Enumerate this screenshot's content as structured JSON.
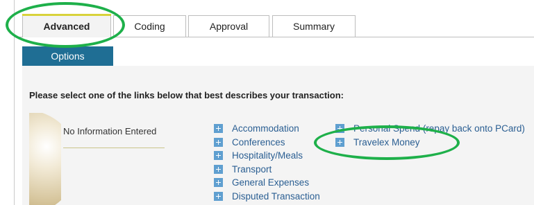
{
  "tabs": [
    {
      "label": "Advanced",
      "active": true
    },
    {
      "label": "Coding",
      "active": false
    },
    {
      "label": "Approval",
      "active": false
    },
    {
      "label": "Summary",
      "active": false
    }
  ],
  "subtab": {
    "label": "Options"
  },
  "instruction": "Please select one of the links below that best describes your transaction:",
  "info_panel": {
    "text": "No Information Entered"
  },
  "links_col1": [
    "Accommodation",
    "Conferences",
    "Hospitality/Meals",
    "Transport",
    "General Expenses",
    "Disputed Transaction"
  ],
  "links_col2": [
    "Personal Spend (repay back onto PCard)",
    "Travelex Money"
  ],
  "colors": {
    "accent": "#1f6e94",
    "link": "#2a5e92",
    "plus_icon": "#5f9fd0",
    "highlight": "#1eb04a"
  }
}
